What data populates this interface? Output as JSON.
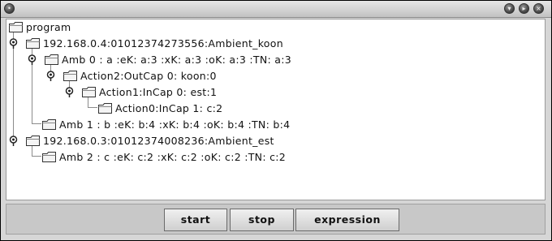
{
  "window": {
    "controls": [
      {
        "name": "window-menu-icon",
        "glyph": "•"
      },
      {
        "name": "minimize-icon",
        "glyph": "▾"
      },
      {
        "name": "maximize-icon",
        "glyph": "▸"
      },
      {
        "name": "close-icon",
        "glyph": "×"
      }
    ]
  },
  "tree": {
    "nodes": [
      {
        "label": "program"
      },
      {
        "label": "192.168.0.4:01012374273556:Ambient_koon"
      },
      {
        "label": "Amb 0 : a :eK:  a:3 :xK:  a:3 :oK:  a:3 :TN:  a:3"
      },
      {
        "label": "Action2:OutCap 0: koon:0"
      },
      {
        "label": "Action1:InCap 0: est:1"
      },
      {
        "label": "Action0:InCap 1: c:2"
      },
      {
        "label": "Amb 1 : b :eK:  b:4 :xK:  b:4 :oK:  b:4 :TN:  b:4"
      },
      {
        "label": "192.168.0.3:01012374008236:Ambient_est"
      },
      {
        "label": "Amb 2 : c :eK:  c:2 :xK:  c:2 :oK:  c:2 :TN:  c:2"
      }
    ]
  },
  "buttons": {
    "start": "start",
    "stop": "stop",
    "expression": "expression"
  }
}
